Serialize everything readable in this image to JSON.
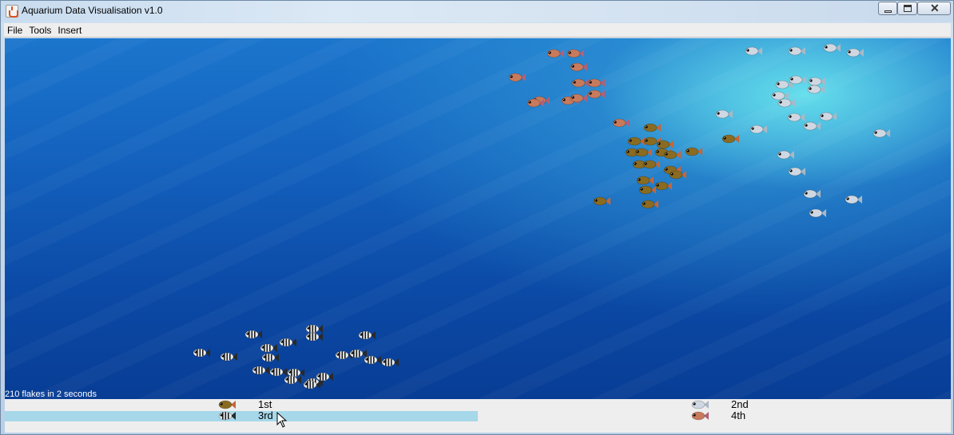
{
  "window": {
    "title": "Aquarium Data Visualisation v1.0"
  },
  "menu": [
    "File",
    "Tools",
    "Insert"
  ],
  "status": "210 flakes in 2 seconds",
  "legend": [
    {
      "rank": "1st",
      "fish": "brown-fish-icon",
      "color": "#8a6b22"
    },
    {
      "rank": "2nd",
      "fish": "silver-fish-icon",
      "color": "#c7d3df"
    },
    {
      "rank": "3rd",
      "fish": "striped-fish-icon",
      "color": "#1c1c1c",
      "highlighted": true
    },
    {
      "rank": "4th",
      "fish": "red-fish-icon",
      "color": "#c87a5c"
    }
  ],
  "colors": {
    "water_top": "#1c76cc",
    "water_bottom": "#083d95",
    "highlight": "#a6d8ea",
    "brown_fish": "#8a6b22",
    "red_fish": "#c87a5c",
    "silver_fish": "#cfd8e2"
  }
}
